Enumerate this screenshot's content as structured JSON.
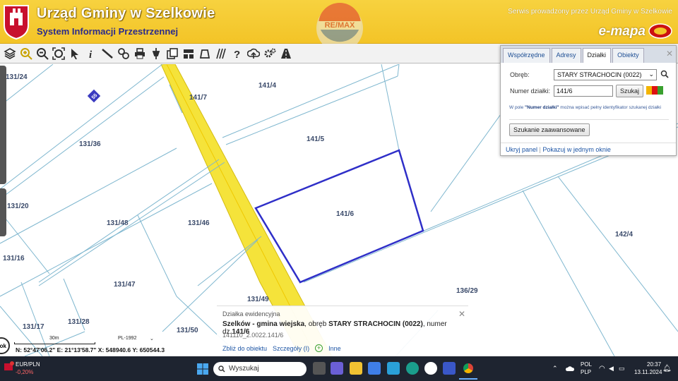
{
  "header": {
    "title": "Urząd Gminy w Szelkowie",
    "subtitle": "System Informacji Przestrzennej",
    "service_note": "Serwis prowadzony przez Urząd Gminy w Szelkowie",
    "emapa": "e-mapa",
    "watermark": "RE/MAX"
  },
  "toolbar": {
    "tools": [
      "layers-icon",
      "zoom-in-icon",
      "zoom-out-icon",
      "full-extent-icon",
      "select-arrow-icon",
      "info-icon",
      "measure-icon",
      "link-icon",
      "print-icon",
      "locate-icon",
      "copy-icon",
      "layout-icon",
      "map-view-icon",
      "hatch-icon",
      "help-icon",
      "cloud-upload-icon",
      "settings-icon",
      "road-icon"
    ],
    "colors": {
      "zoom": "#c8a200",
      "default": "#2e2e2e"
    }
  },
  "map": {
    "plots": [
      {
        "id": "131/24"
      },
      {
        "id": "141/7"
      },
      {
        "id": "141/4"
      },
      {
        "id": "131/36"
      },
      {
        "id": "141/5"
      },
      {
        "id": "141/6"
      },
      {
        "id": "131/20"
      },
      {
        "id": "131/48"
      },
      {
        "id": "131/46"
      },
      {
        "id": "142/4"
      },
      {
        "id": "131/16"
      },
      {
        "id": "131/47"
      },
      {
        "id": "136/29"
      },
      {
        "id": "131/49"
      },
      {
        "id": "131/17"
      },
      {
        "id": "131/28"
      },
      {
        "id": "131/50"
      }
    ],
    "road_sign": "55",
    "selected_color": "#2f2fc8",
    "road_color": "#f5e33a"
  },
  "panel": {
    "tabs": [
      "Współrzędne",
      "Adresy",
      "Działki",
      "Obiekty"
    ],
    "active_tab": "Działki",
    "obreb_label": "Obręb:",
    "obreb_value": "STARY STRACHOCIN (0022)",
    "numer_label": "Numer działki:",
    "numer_value": "141/6",
    "search_button": "Szukaj",
    "hint_prefix": "W pole ",
    "hint_bold": "\"Numer działki\"",
    "hint_suffix": " można wpisać pełny identyfikator szukanej działki",
    "advanced_button": "Szukanie zaawansowane",
    "hide_link": "Ukryj panel",
    "show_link": "Pokazuj w jednym oknie"
  },
  "info": {
    "heading": "Działka ewidencyjna",
    "place": "Szelków - gmina wiejska",
    "mid": ", obręb ",
    "obreb": "STARY STRACHOCIN (0022)",
    "numer_prefix": ", numer dz.",
    "numer": "141/6",
    "identifier": "141110_2.0022.141/6",
    "zoom_link": "Zbliż do obiektu",
    "details_link": "Szczegóły (I)",
    "other_link": "Inne"
  },
  "scale": {
    "label": "30m",
    "projection": "PL-1992"
  },
  "coords": {
    "n_label": "N:",
    "n": "52°47'06.2\"",
    "e_label": "E:",
    "e": "21°13'58.7\"",
    "x_label": "X:",
    "x": "548940.6",
    "y_label": "Y:",
    "y": "650544.3"
  },
  "ok_label": "ok",
  "taskbar": {
    "currency_pair": "EUR/PLN",
    "currency_change": "-0,20%",
    "search_placeholder": "Wyszukaj",
    "lang_1": "POL",
    "lang_2": "PLP",
    "time": "20:37",
    "date": "13.11.2024"
  }
}
